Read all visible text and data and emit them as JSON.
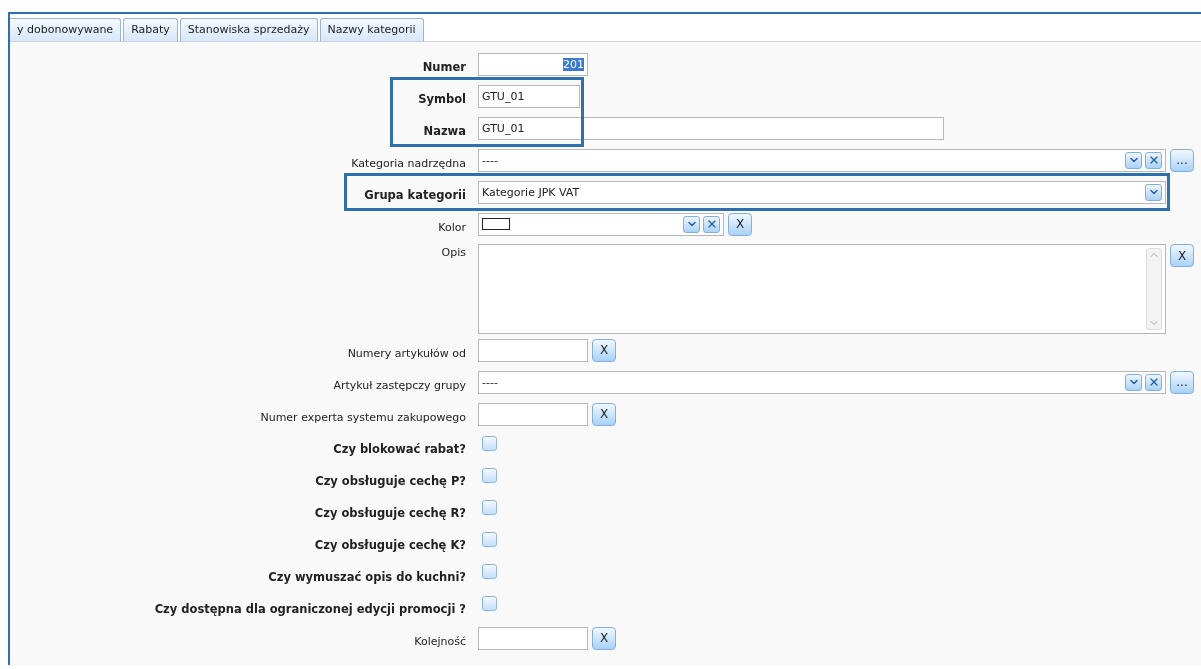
{
  "tabs": [
    {
      "label": "y dobonowywane"
    },
    {
      "label": "Rabaty"
    },
    {
      "label": "Stanowiska sprzedaży"
    },
    {
      "label": "Nazwy kategorii"
    }
  ],
  "form": [
    {
      "kind": "number",
      "label": "Numer",
      "bold": true,
      "value": "201",
      "text_selected": true,
      "highlighted": false
    },
    {
      "kind": "short_text",
      "label": "Symbol",
      "bold": true,
      "value": "GTU_01",
      "highlighted": true
    },
    {
      "kind": "long_text",
      "label": "Nazwa",
      "bold": true,
      "value": "GTU_01",
      "highlighted": true
    },
    {
      "kind": "lookup",
      "label": "Kategoria nadrzędna",
      "bold": false,
      "value": "----",
      "more_button": "...",
      "highlighted": false
    },
    {
      "kind": "select",
      "label": "Grupa kategorii",
      "bold": true,
      "value": "Kategorie JPK VAT",
      "highlighted": true
    },
    {
      "kind": "color",
      "label": "Kolor",
      "bold": false,
      "clear_button": "X",
      "highlighted": false
    },
    {
      "kind": "memo",
      "label": "Opis",
      "bold": false,
      "clear_button": "X",
      "highlighted": false
    },
    {
      "kind": "clear_text",
      "label": "Numery artykułów od",
      "bold": false,
      "clear_button": "X",
      "highlighted": false
    },
    {
      "kind": "lookup",
      "label": "Artykuł zastępczy grupy",
      "bold": false,
      "value": "----",
      "more_button": "...",
      "highlighted": false
    },
    {
      "kind": "clear_text",
      "label": "Numer experta systemu zakupowego",
      "bold": false,
      "clear_button": "X",
      "highlighted": false
    },
    {
      "kind": "checkbox",
      "label": "Czy blokować rabat?",
      "bold": true,
      "checked": false,
      "highlighted": false
    },
    {
      "kind": "checkbox",
      "label": "Czy obsługuje cechę P?",
      "bold": true,
      "checked": false,
      "highlighted": false
    },
    {
      "kind": "checkbox",
      "label": "Czy obsługuje cechę R?",
      "bold": true,
      "checked": false,
      "highlighted": false
    },
    {
      "kind": "checkbox",
      "label": "Czy obsługuje cechę K?",
      "bold": true,
      "checked": false,
      "highlighted": false
    },
    {
      "kind": "checkbox",
      "label": "Czy wymuszać opis do kuchni?",
      "bold": true,
      "checked": false,
      "highlighted": false
    },
    {
      "kind": "checkbox",
      "label": "Czy dostępna dla ograniczonej edycji promocji ?",
      "bold": true,
      "checked": false,
      "highlighted": false
    },
    {
      "kind": "clear_text",
      "label": "Kolejność",
      "bold": false,
      "clear_button": "X",
      "highlighted": false
    }
  ]
}
